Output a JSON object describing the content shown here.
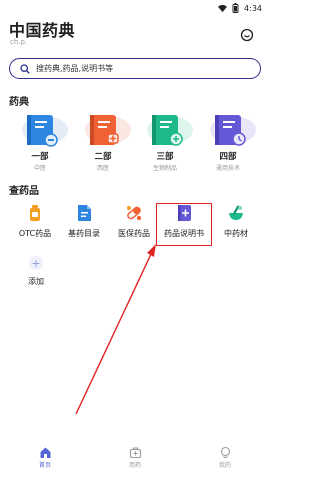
{
  "status_bar": {
    "time": "4:34"
  },
  "header": {
    "title": "中国药典",
    "subtitle": "ch.p."
  },
  "search": {
    "placeholder": "搜药典,药品,说明书等"
  },
  "pharmacopoeia": {
    "title": "药典",
    "books": [
      {
        "label": "一部",
        "sub": "中医",
        "color": "#2f86e0"
      },
      {
        "label": "二部",
        "sub": "西医",
        "color": "#f06236"
      },
      {
        "label": "三部",
        "sub": "生物制品",
        "color": "#1eb98a"
      },
      {
        "label": "四部",
        "sub": "通用技术",
        "color": "#6558d6"
      }
    ]
  },
  "drug_lookup": {
    "title": "查药品",
    "tools": [
      {
        "label": "OTC药品",
        "icon": "otc-bottle-icon"
      },
      {
        "label": "基药目录",
        "icon": "catalog-icon"
      },
      {
        "label": "医保药品",
        "icon": "insurance-pills-icon"
      },
      {
        "label": "药品说明书",
        "icon": "instruction-book-icon"
      },
      {
        "label": "中药材",
        "icon": "mortar-herb-icon"
      }
    ],
    "add_label": "添加"
  },
  "bottom_nav": {
    "items": [
      {
        "label": "首页",
        "icon": "home-icon",
        "active": true
      },
      {
        "label": "用药",
        "icon": "medicine-box-icon",
        "active": false
      },
      {
        "label": "我的",
        "icon": "profile-icon",
        "active": false
      }
    ]
  },
  "colors": {
    "accent": "#5567d5",
    "search_border": "#2f2f8a",
    "annotation": "#e02424"
  }
}
